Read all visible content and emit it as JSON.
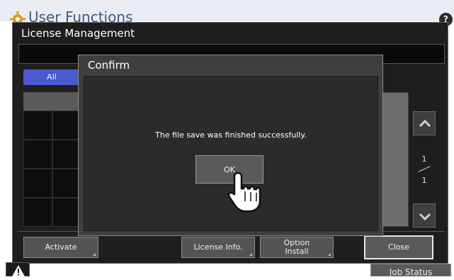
{
  "app": {
    "title": "User Functions",
    "help_label": "?"
  },
  "window": {
    "title": "License Management",
    "tabs": [
      {
        "label": "All"
      }
    ],
    "pager": {
      "current": "1",
      "total": "1"
    }
  },
  "footer_buttons": {
    "activate": "Activate",
    "license_info": "License Info.",
    "option_install_line1": "Option",
    "option_install_line2": "Install",
    "close": "Close"
  },
  "status_bar": {
    "job_status": "Job Status"
  },
  "dialog": {
    "title": "Confirm",
    "message": "The file save was finished successfully.",
    "ok_label": "OK"
  },
  "icons": {
    "gear": "gear-icon",
    "help": "help-icon",
    "warning": "warning-icon",
    "scroll_up": "chevron-up-icon",
    "scroll_down": "chevron-down-icon",
    "cursor": "hand-pointer-icon"
  }
}
